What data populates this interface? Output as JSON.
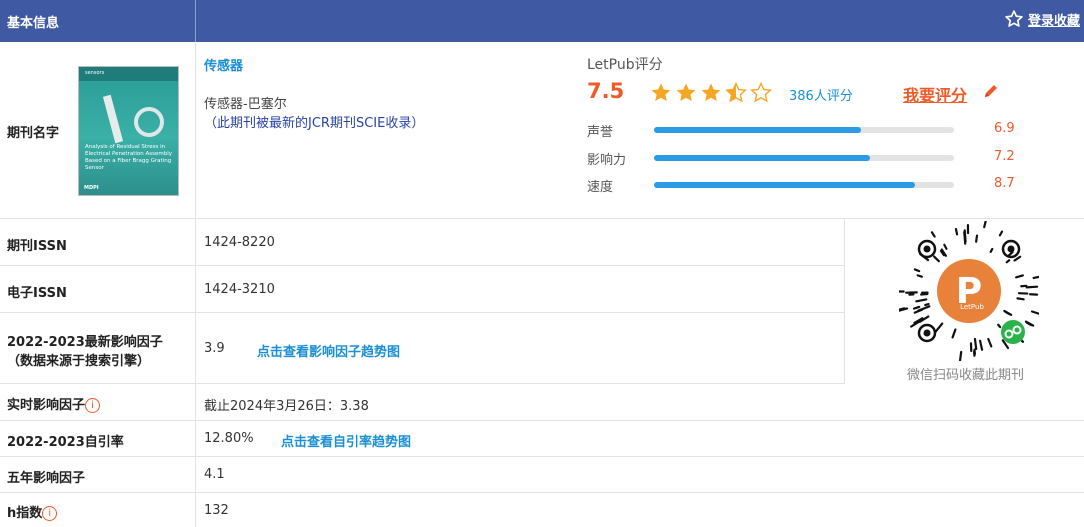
{
  "header": {
    "title": "基本信息",
    "favorite_label": "登录收藏"
  },
  "journal": {
    "label": "期刊名字",
    "name_link": "传感器",
    "name_full": "传感器-巴塞尔",
    "jcr_note": "（此期刊被最新的JCR期刊SCIE收录）",
    "cover": {
      "brand": "sensors",
      "title": "Analysis of Residual Stress in Electrical Penetration Assembly Based on a Fiber Bragg Grating Sensor",
      "publisher": "MDPI"
    }
  },
  "rating": {
    "label": "LetPub评分",
    "score": "7.5",
    "stars": 3.5,
    "raters": "386人评分",
    "rate_button": "我要评分",
    "bars": [
      {
        "label": "声誉",
        "value": "6.9",
        "fraction": 0.69
      },
      {
        "label": "影响力",
        "value": "7.2",
        "fraction": 0.72
      },
      {
        "label": "速度",
        "value": "8.7",
        "fraction": 0.87
      }
    ]
  },
  "rows": {
    "issn": {
      "label": "期刊ISSN",
      "value": "1424-8220"
    },
    "eissn": {
      "label": "电子ISSN",
      "value": "1424-3210"
    },
    "if": {
      "label_line1": "2022-2023最新影响因子",
      "label_line2": "（数据来源于搜索引擎）",
      "value": "3.9",
      "link": "点击查看影响因子趋势图"
    },
    "realtime_if": {
      "label": "实时影响因子",
      "value": "截止2024年3月26日：3.38"
    },
    "self_cite": {
      "label": "2022-2023自引率",
      "value": "12.80%",
      "link": "点击查看自引率趋势图"
    },
    "five_year_if": {
      "label": "五年影响因子",
      "value": "4.1"
    },
    "h_index": {
      "label": "h指数",
      "value": "132"
    }
  },
  "qr": {
    "caption": "微信扫码收藏此期刊",
    "logo_text": "LetPub"
  },
  "colors": {
    "header_bg": "#3f5aa3",
    "accent_orange": "#f05a28",
    "link_blue": "#1a8fd6",
    "bar_blue": "#2c9be6",
    "star": "#f5a623"
  },
  "icons": [
    "star-outline-icon",
    "star-icon",
    "pencil-icon",
    "info-icon",
    "wechat-mini-program-icon"
  ]
}
